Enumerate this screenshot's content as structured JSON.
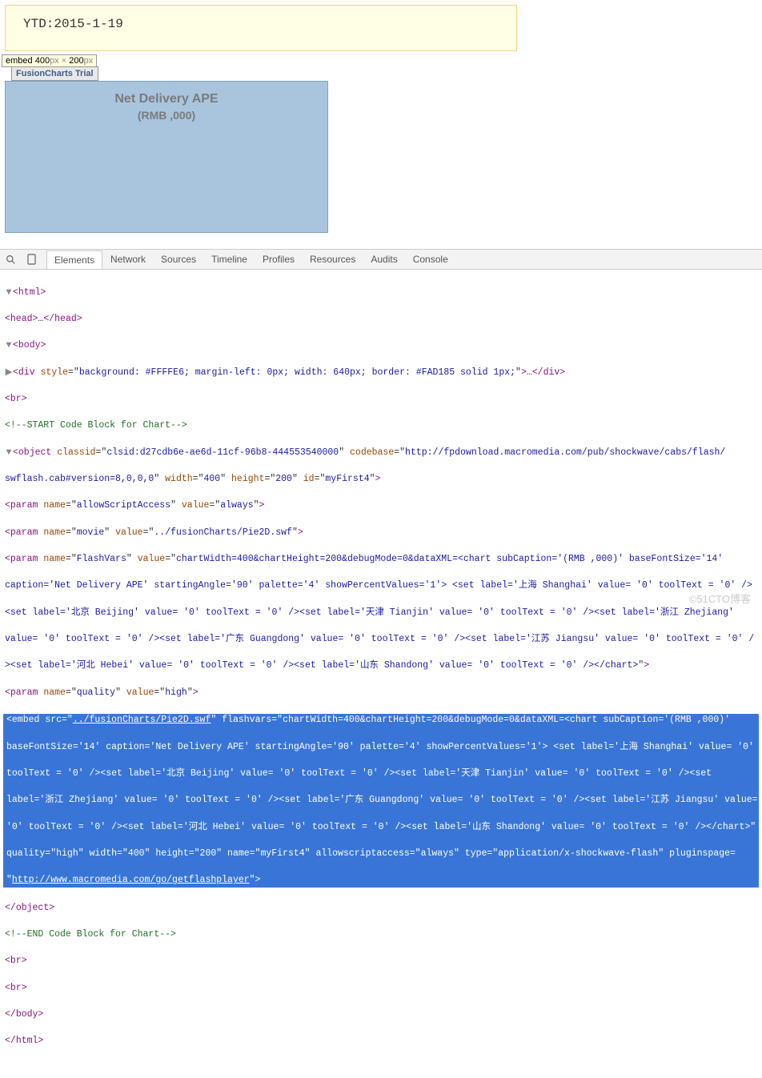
{
  "header": {
    "ytd_label": "YTD:2015-1-19"
  },
  "tooltip": {
    "prefix": "embed ",
    "w": "400",
    "x": "px × ",
    "h": "200",
    "suffix": "px"
  },
  "chart": {
    "trial": "FusionCharts Trial",
    "title": "Net Delivery APE",
    "subtitle": "(RMB ,000)"
  },
  "devtools": {
    "tabs": [
      "Elements",
      "Network",
      "Sources",
      "Timeline",
      "Profiles",
      "Resources",
      "Audits",
      "Console"
    ]
  },
  "dom": {
    "html_open": "<html>",
    "head": "<head>…</head>",
    "body_open": "<body>",
    "div_style": "<div style=\"background: #FFFFE6; margin-left: 0px; width: 640px; border: #FAD185 solid 1px;\">…</div>",
    "br": "<br>",
    "comment_start": "<!--START Code Block for Chart-->",
    "object_open1": "<object classid=\"clsid:d27cdb6e-ae6d-11cf-96b8-444553540000\" codebase=\"http://fpdownload.macromedia.com/pub/shockwave/cabs/flash/",
    "object_open2": "swflash.cab#version=8,0,0,0\" width=\"400\" height=\"200\" id=\"myFirst4\">",
    "param1": "<param name=\"allowScriptAccess\" value=\"always\">",
    "param2": "<param name=\"movie\" value=\"../fusionCharts/Pie2D.swf\">",
    "param3a": "<param name=\"FlashVars\" value=\"chartWidth=400&chartHeight=200&debugMode=0&dataXML=<chart subCaption='(RMB ,000)' baseFontSize='14'",
    "param3b": "caption='Net Delivery APE' startingAngle='90' palette='4' showPercentValues='1'> <set label='上海 Shanghai' value= '0' toolText = '0' />",
    "param3c": "<set label='北京 Beijing' value= '0' toolText = '0' /><set label='天津 Tianjin' value= '0' toolText = '0' /><set label='浙江 Zhejiang'",
    "param3d": "value= '0' toolText = '0' /><set label='广东 Guangdong' value= '0' toolText = '0' /><set label='江苏 Jiangsu' value= '0' toolText = '0' /",
    "param3e": "><set label='河北 Hebei' value= '0' toolText = '0' /><set label='山东 Shandong' value= '0' toolText = '0' /></chart>\">",
    "param4": "<param name=\"quality\" value=\"high\">",
    "embed1": "<embed src=\"../fusionCharts/Pie2D.swf\" flashvars=\"chartWidth=400&chartHeight=200&debugMode=0&dataXML=<chart subCaption='(RMB ,000)'",
    "embed2": "baseFontSize='14' caption='Net Delivery APE' startingAngle='90' palette='4' showPercentValues='1'> <set label='上海 Shanghai' value= '0'",
    "embed3": "toolText = '0' /><set label='北京 Beijing' value= '0' toolText = '0' /><set label='天津 Tianjin' value= '0' toolText = '0' /><set",
    "embed4": "label='浙江 Zhejiang' value= '0' toolText = '0' /><set label='广东 Guangdong' value= '0' toolText = '0' /><set label='江苏 Jiangsu' value=",
    "embed5": "'0' toolText = '0' /><set label='河北 Hebei' value= '0' toolText = '0' /><set label='山东 Shandong' value= '0' toolText = '0' /></chart>\"",
    "embed6": "quality=\"high\" width=\"400\" height=\"200\" name=\"myFirst4\" allowscriptaccess=\"always\" type=\"application/x-shockwave-flash\" pluginspage=",
    "embed7": "\"http://www.macromedia.com/go/getflashplayer\">",
    "object_close": "</object>",
    "comment_end": "<!--END Code Block for Chart-->",
    "body_close": "</body>",
    "html_close": "</html>"
  },
  "watermark": "©51CTO博客",
  "chart_data": {
    "type": "pie",
    "title": "Net Delivery APE",
    "subtitle": "(RMB ,000)",
    "categories": [
      "上海 Shanghai",
      "北京 Beijing",
      "天津 Tianjin",
      "浙江 Zhejiang",
      "广东 Guangdong",
      "江苏 Jiangsu",
      "河北 Hebei",
      "山东 Shandong"
    ],
    "values": [
      0,
      0,
      0,
      0,
      0,
      0,
      0,
      0
    ],
    "startingAngle": 90,
    "palette": 4,
    "showPercentValues": 1
  }
}
